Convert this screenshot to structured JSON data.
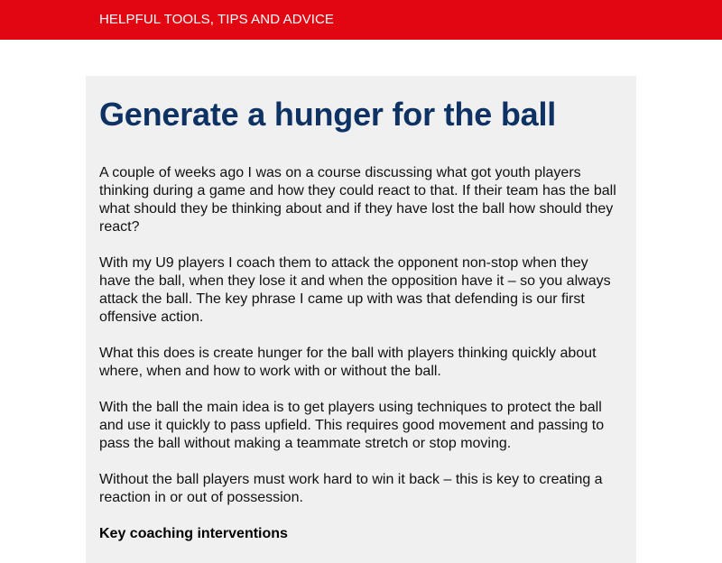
{
  "header": {
    "nav_label": "HELPFUL TOOLS, TIPS AND ADVICE"
  },
  "article": {
    "title": "Generate a hunger for the ball",
    "paragraphs": [
      "A couple of weeks ago I was on a course discussing what got youth players thinking during a game and how they could react to that. If their team has the ball what should they be thinking about and if they have lost the ball how should they react?",
      "With my U9 players I coach them to attack the opponent non-stop when they have the ball, when they lose it and when the opposition have it – so you always attack the ball. The key phrase I came up with was that defending is our first offensive action.",
      "What this does is create hunger for the ball with players thinking quickly about where, when and how to work with or without the ball.",
      "With the ball the main idea is to get players using techniques to protect the ball and use it quickly to pass upfield. This requires good movement and passing to pass the ball without making a teammate stretch or stop moving.",
      "Without the ball players must work hard to win it back – this is key to creating a reaction in or out of possession."
    ],
    "subheading": "Key coaching interventions"
  }
}
